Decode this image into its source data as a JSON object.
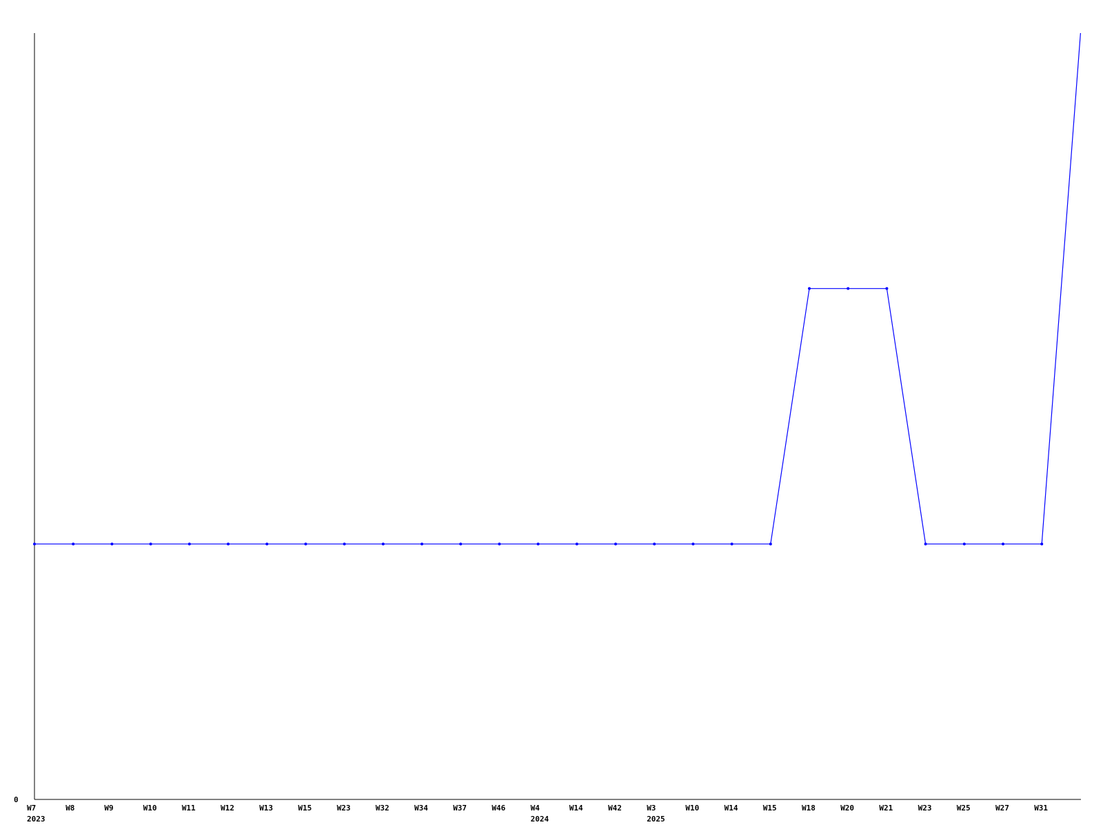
{
  "chart_data": {
    "type": "line",
    "title": "",
    "xlabel": "",
    "ylabel": "",
    "categories": [
      "W7",
      "W8",
      "W9",
      "W10",
      "W11",
      "W12",
      "W13",
      "W15",
      "W23",
      "W32",
      "W34",
      "W37",
      "W46",
      "W4",
      "W14",
      "W42",
      "W3",
      "W10",
      "W14",
      "W15",
      "W18",
      "W20",
      "W21",
      "W23",
      "W25",
      "W27",
      "W31"
    ],
    "year_labels": [
      {
        "index": 0,
        "label": "2023"
      },
      {
        "index": 13,
        "label": "2024"
      },
      {
        "index": 16,
        "label": "2025"
      }
    ],
    "series": [
      {
        "color": "#0000ff",
        "values": [
          1,
          1,
          1,
          1,
          1,
          1,
          1,
          1,
          1,
          1,
          1,
          1,
          1,
          1,
          1,
          1,
          1,
          1,
          1,
          1,
          2,
          2,
          2,
          1,
          1,
          1,
          1
        ],
        "continues_above_top_after_last_point": true
      }
    ],
    "y_tick_labels": [
      {
        "value": 0,
        "label": "0"
      }
    ],
    "ylim": [
      0,
      3
    ],
    "grid": false,
    "legend": "none"
  }
}
